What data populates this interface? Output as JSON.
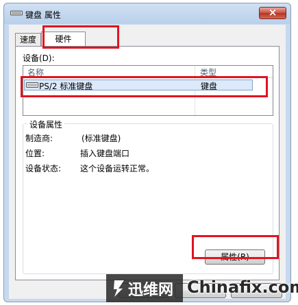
{
  "window": {
    "title": "键盘 属性",
    "close_label": "×"
  },
  "tabs": [
    {
      "label": "速度"
    },
    {
      "label": "硬件"
    }
  ],
  "devices": {
    "label": "设备(D):",
    "columns": {
      "name": "名称",
      "type": "类型"
    },
    "rows": [
      {
        "name": "PS/2 标准键盘",
        "type": "键盘"
      }
    ]
  },
  "properties": {
    "title": "设备属性",
    "items": [
      {
        "label": "制造商:",
        "value": "(标准键盘)"
      },
      {
        "label": "位置:",
        "value": "插入键盘端口"
      },
      {
        "label": "设备状态:",
        "value": "这个设备运转正常。"
      }
    ],
    "button_label": "属性(R)"
  },
  "watermark": {
    "brand_cn": "迅维网",
    "brand_en": "Chinafix.com"
  },
  "colors": {
    "highlight": "#e0141f",
    "window_frame": "#b9d0ea",
    "selection": "#dce9f9"
  }
}
